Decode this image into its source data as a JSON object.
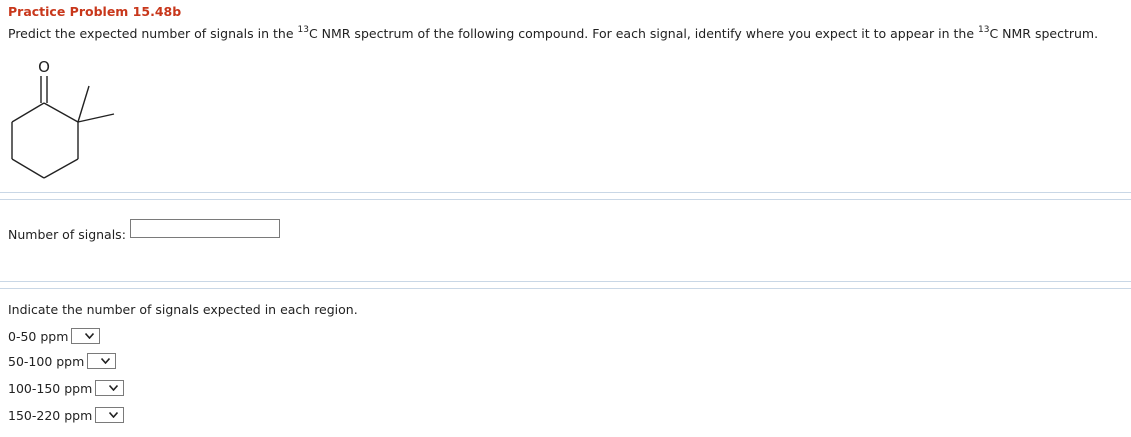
{
  "header": {
    "title": "Practice Problem 15.48b",
    "question_part1": "Predict the expected number of signals in the ",
    "question_sup1": "13",
    "question_part2": "C NMR spectrum of the following compound. For each signal, identify where you expect it to appear in the ",
    "question_sup2": "13",
    "question_part3": "C NMR spectrum."
  },
  "molecule": {
    "atom_label": "O"
  },
  "signals": {
    "label": "Number of signals:",
    "value": ""
  },
  "regions": {
    "instruction": "Indicate the number of signals expected in each region.",
    "items": [
      {
        "label": "0-50 ppm",
        "value": ""
      },
      {
        "label": "50-100 ppm",
        "value": ""
      },
      {
        "label": "100-150 ppm",
        "value": ""
      },
      {
        "label": "150-220 ppm",
        "value": ""
      }
    ]
  }
}
